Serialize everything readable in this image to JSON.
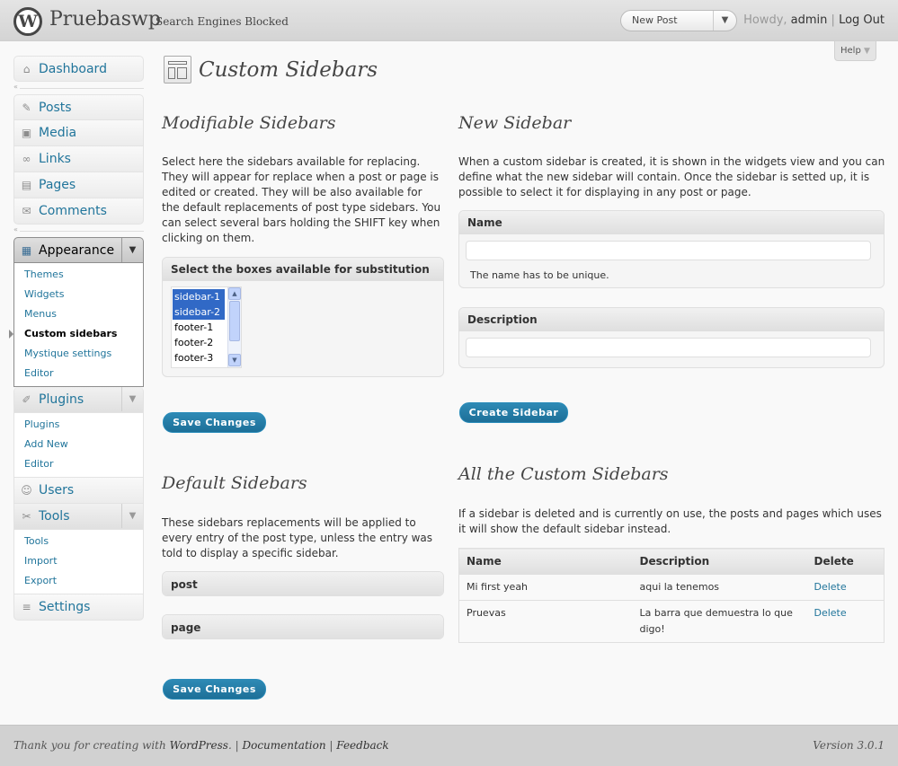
{
  "header": {
    "logo_letter": "W",
    "site_title": "Pruebaswp",
    "site_status": "Search Engines Blocked",
    "favorite_label": "New Post",
    "favorite_toggle": "▼",
    "howdy": "Howdy,",
    "username": "admin",
    "separator": "|",
    "logout": "Log Out"
  },
  "help": {
    "label": "Help",
    "caret": "▼"
  },
  "menu": {
    "dashboard": "Dashboard",
    "posts": "Posts",
    "media": "Media",
    "links": "Links",
    "pages": "Pages",
    "comments": "Comments",
    "appearance": "Appearance",
    "appearance_sub": [
      "Themes",
      "Widgets",
      "Menus",
      "Custom sidebars",
      "Mystique settings",
      "Editor"
    ],
    "plugins": "Plugins",
    "plugins_sub": [
      "Plugins",
      "Add New",
      "Editor"
    ],
    "users": "Users",
    "tools": "Tools",
    "tools_sub": [
      "Tools",
      "Import",
      "Export"
    ],
    "settings": "Settings",
    "toggle": "▼",
    "sep_arrow": "«"
  },
  "page": {
    "title": "Custom Sidebars"
  },
  "modifiable": {
    "title": "Modifiable Sidebars",
    "description": "Select here the sidebars available for replacing. They will appear for replace when a post or page is edited or created. They will be also available for the default replacements of post type sidebars. You can select several bars holding the SHIFT key when clicking on them.",
    "box_title": "Select the boxes available for substitution",
    "options": [
      "sidebar-1",
      "sidebar-2",
      "footer-1",
      "footer-2",
      "footer-3"
    ],
    "save_label": "Save Changes"
  },
  "defaults": {
    "title": "Default Sidebars",
    "description": "These sidebars replacements will be applied to every entry of the post type, unless the entry was told to display a specific sidebar.",
    "post_types": [
      "post",
      "page"
    ],
    "save_label": "Save Changes"
  },
  "new_sidebar": {
    "title": "New Sidebar",
    "description": "When a custom sidebar is created, it is shown in the widgets view and you can define what the new sidebar will contain. Once the sidebar is setted up, it is possible to select it for displaying in any post or page.",
    "name_label": "Name",
    "name_value": "",
    "name_hint": "The name has to be unique.",
    "description_label": "Description",
    "description_value": "",
    "create_label": "Create Sidebar"
  },
  "all_custom": {
    "title": "All the Custom Sidebars",
    "description": "If a sidebar is deleted and is currently on use, the posts and pages which uses it will show the default sidebar instead.",
    "columns": [
      "Name",
      "Description",
      "Delete"
    ],
    "rows": [
      {
        "name": "Mi first yeah",
        "description": "aqui la tenemos",
        "delete": "Delete"
      },
      {
        "name": "Pruevas",
        "description": "La barra que demuestra lo que digo!",
        "delete": "Delete"
      }
    ]
  },
  "footer": {
    "thank_you": "Thank you for creating with",
    "wordpress": "WordPress",
    "period": ".",
    "sep": "|",
    "documentation": "Documentation",
    "feedback": "Feedback",
    "version": "Version 3.0.1"
  },
  "colors": {
    "link": "#21759b",
    "primary_button": "#21759b",
    "selected_option": "#3169c6",
    "header_bg": "#d9d9d9",
    "footer_bg": "#d1d1d1"
  },
  "icons": [
    "wordpress-logo-icon",
    "dashboard-icon",
    "posts-icon",
    "media-icon",
    "links-icon",
    "pages-icon",
    "comments-icon",
    "appearance-icon",
    "plugins-icon",
    "users-icon",
    "tools-icon",
    "settings-icon",
    "themes-page-icon"
  ]
}
